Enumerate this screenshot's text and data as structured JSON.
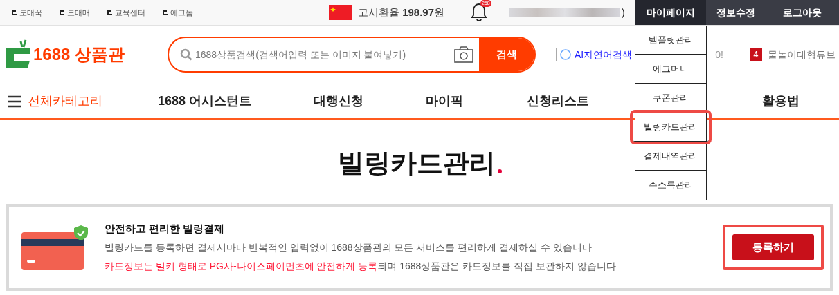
{
  "top_links": [
    "도매꾹",
    "도매매",
    "교육센터",
    "에그돔"
  ],
  "exchange": {
    "label": "고시환율",
    "value": "198.97",
    "unit": "원"
  },
  "notification": {
    "badge": "258"
  },
  "user": {
    "suffix": ")"
  },
  "account_menu": [
    {
      "label": "마이페이지",
      "selected": true
    },
    {
      "label": "정보수정",
      "selected": false
    },
    {
      "label": "로그아웃",
      "selected": false
    }
  ],
  "dropdown": [
    {
      "label": "템플릿관리",
      "highlighted": false
    },
    {
      "label": "에그머니",
      "highlighted": false
    },
    {
      "label": "쿠폰관리",
      "highlighted": false
    },
    {
      "label": "빌링카드관리",
      "highlighted": true
    },
    {
      "label": "결제내역관리",
      "highlighted": false
    },
    {
      "label": "주소록관리",
      "highlighted": false
    }
  ],
  "logo": {
    "text": "1688 상품관"
  },
  "search": {
    "placeholder": "1688상품검색(검색어입력 또는 이미지 붙여넣기)",
    "button": "검색"
  },
  "ai_search": {
    "label": "AI자연어검색",
    "checked": false
  },
  "partial_text": "0!",
  "trending": {
    "rank": "4",
    "keyword": "물놀이대형튜브"
  },
  "nav": {
    "all_categories": "전체카테고리",
    "items": [
      "1688 어시스턴트",
      "대행신청",
      "마이픽",
      "신청리스트",
      "활용법"
    ]
  },
  "page_title": "빌링카드관리",
  "billing_card": {
    "heading": "안전하고 편리한 빌링결제",
    "description": "빌링카드를 등록하면 결제시마다 반복적인 입력없이 1688상품관의 모든 서비스를 편리하게 결제하실 수 있습니다",
    "notice_highlight": "카드정보는 빌키 형태로 PG사-나이스페이먼츠에 안전하게 등록",
    "notice_rest": "되며 1688상품관은 카드정보를 직접 보관하지 않습니다",
    "button": "등록하기",
    "button_highlighted": true
  }
}
